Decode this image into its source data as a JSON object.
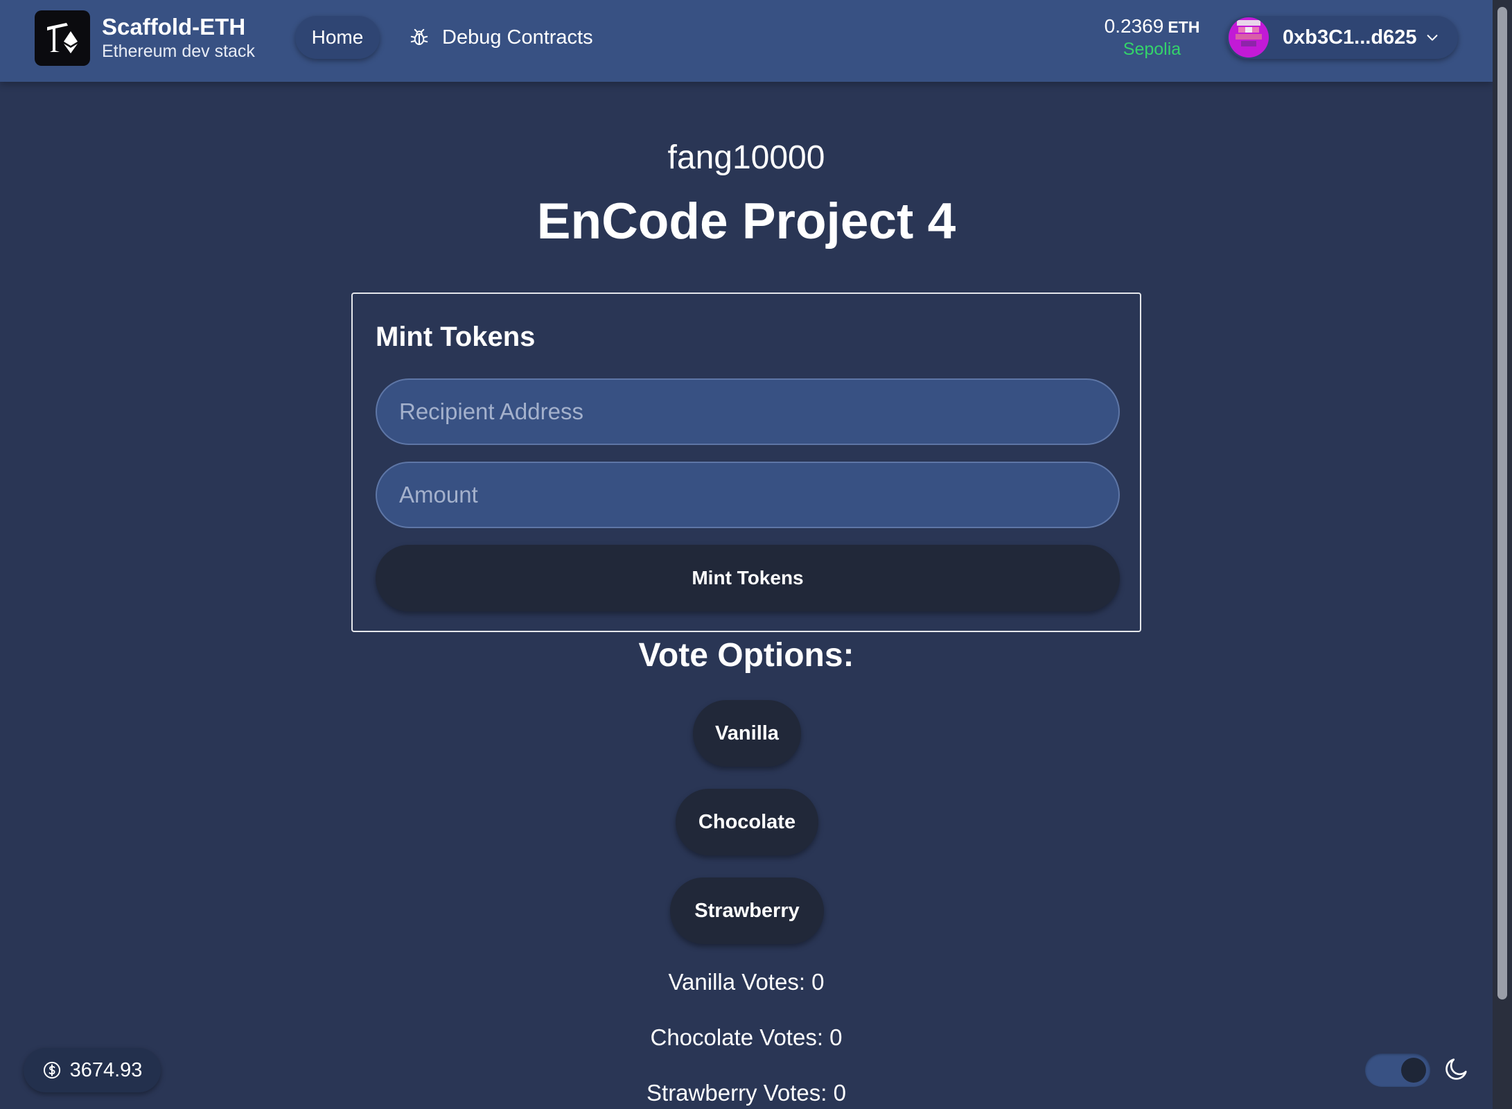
{
  "header": {
    "brand_title": "Scaffold-ETH",
    "brand_subtitle": "Ethereum dev stack",
    "nav": {
      "home_label": "Home",
      "debug_label": "Debug Contracts"
    },
    "balance": {
      "amount": "0.2369",
      "unit": "ETH",
      "network": "Sepolia"
    },
    "account": {
      "address": "0xb3C1...d625"
    }
  },
  "main": {
    "subtitle": "fang10000",
    "title": "EnCode Project 4",
    "mint_card": {
      "title": "Mint Tokens",
      "recipient_placeholder": "Recipient Address",
      "amount_placeholder": "Amount",
      "button_label": "Mint Tokens"
    },
    "vote": {
      "heading": "Vote Options:",
      "options": [
        "Vanilla",
        "Chocolate",
        "Strawberry"
      ],
      "counts": [
        "Vanilla Votes: 0",
        "Chocolate Votes: 0",
        "Strawberry Votes: 0"
      ]
    }
  },
  "footer": {
    "eth_price": "3674.93"
  },
  "colors": {
    "background": "#2a3655",
    "header": "#385183",
    "button_dark": "#212839",
    "network_green": "#34d36b"
  },
  "icons": {
    "logo": "scaffold-eth-logo-icon",
    "debug": "bug-icon",
    "chevron": "chevron-down-icon",
    "price": "dollar-circle-icon",
    "theme": "moon-icon"
  }
}
